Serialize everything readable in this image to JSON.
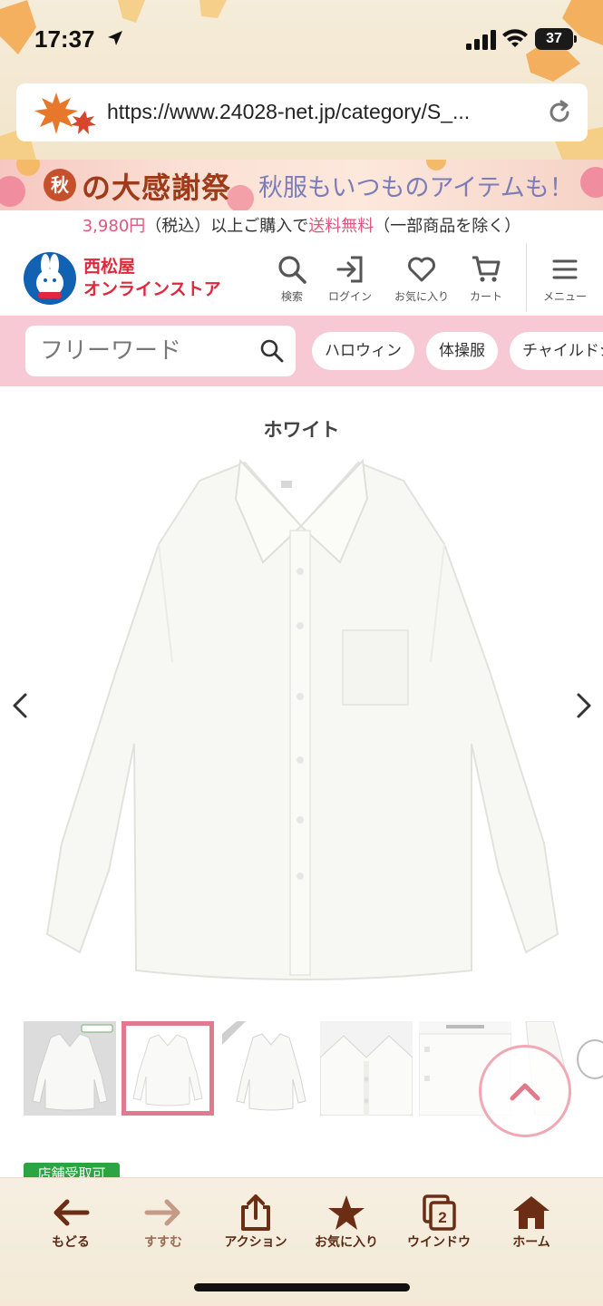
{
  "status_bar": {
    "time": "17:37",
    "battery": "37"
  },
  "browser": {
    "url": "https://www.24028-net.jp/category/S_..."
  },
  "campaign": {
    "badge": "秋",
    "title": "の大感謝祭",
    "subtitle": "秋服もいつものアイテムも！"
  },
  "shipping": {
    "price": "3,980円",
    "middle": "（税込）以上ご購入で",
    "free": "送料無料",
    "tail": "（一部商品を除く）"
  },
  "header": {
    "logo_line1": "西松屋",
    "logo_line2": "オンラインストア",
    "search_label": "検索",
    "login_label": "ログイン",
    "favorites_label": "お気に入り",
    "cart_label": "カート",
    "menu_label": "メニュー"
  },
  "search": {
    "placeholder": "フリーワード",
    "chips": [
      "ハロウィン",
      "体操服",
      "チャイルドシ"
    ]
  },
  "product": {
    "color_name": "ホワイト",
    "store_pickup_badge": "店舗受取可"
  },
  "toolbar": {
    "back": "もどる",
    "forward": "すすむ",
    "action": "アクション",
    "bookmark": "お気に入り",
    "windows": "ウインドウ",
    "window_count": "2",
    "home": "ホーム"
  },
  "colors": {
    "accent_pink": "#e0577c",
    "toolbar_brown": "#6b2e14",
    "search_strip": "#f6c9d5"
  }
}
